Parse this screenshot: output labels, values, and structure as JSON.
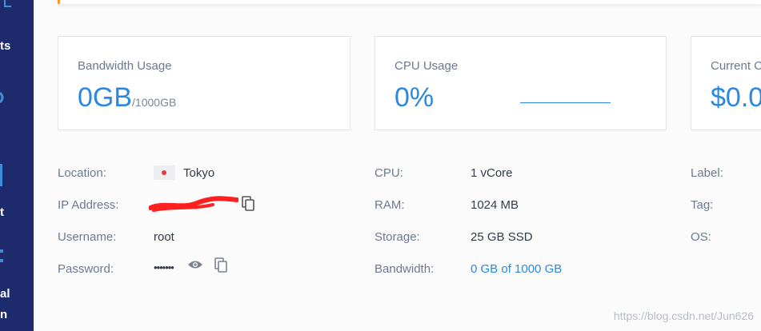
{
  "sidebar": {
    "fragments": [
      "ts",
      "t",
      "al",
      "n"
    ]
  },
  "stats": {
    "bandwidth": {
      "label": "Bandwidth Usage",
      "value": "0GB",
      "unit": "/1000GB"
    },
    "cpu": {
      "label": "CPU Usage",
      "value": "0%"
    },
    "cost": {
      "label": "Current C",
      "value": "$0.0"
    }
  },
  "server": {
    "location": {
      "label": "Location:",
      "value": "Tokyo",
      "flag": "japan-flag-icon"
    },
    "ip": {
      "label": "IP Address:",
      "value": ""
    },
    "username": {
      "label": "Username:",
      "value": "root"
    },
    "password": {
      "label": "Password:",
      "value": "•••••••"
    }
  },
  "specs": {
    "cpu": {
      "label": "CPU:",
      "value": "1 vCore"
    },
    "ram": {
      "label": "RAM:",
      "value": "1024 MB"
    },
    "storage": {
      "label": "Storage:",
      "value": "25 GB SSD"
    },
    "bandwidth": {
      "label": "Bandwidth:",
      "value": "0 GB of 1000 GB"
    }
  },
  "meta": {
    "label": {
      "label": "Label:"
    },
    "tag": {
      "label": "Tag:"
    },
    "os": {
      "label": "OS:"
    }
  },
  "watermark": "https://blog.csdn.net/Jun626",
  "colors": {
    "accent": "#2b88e0",
    "sidebar": "#1d2a6b",
    "highlight": "#f39c32"
  }
}
